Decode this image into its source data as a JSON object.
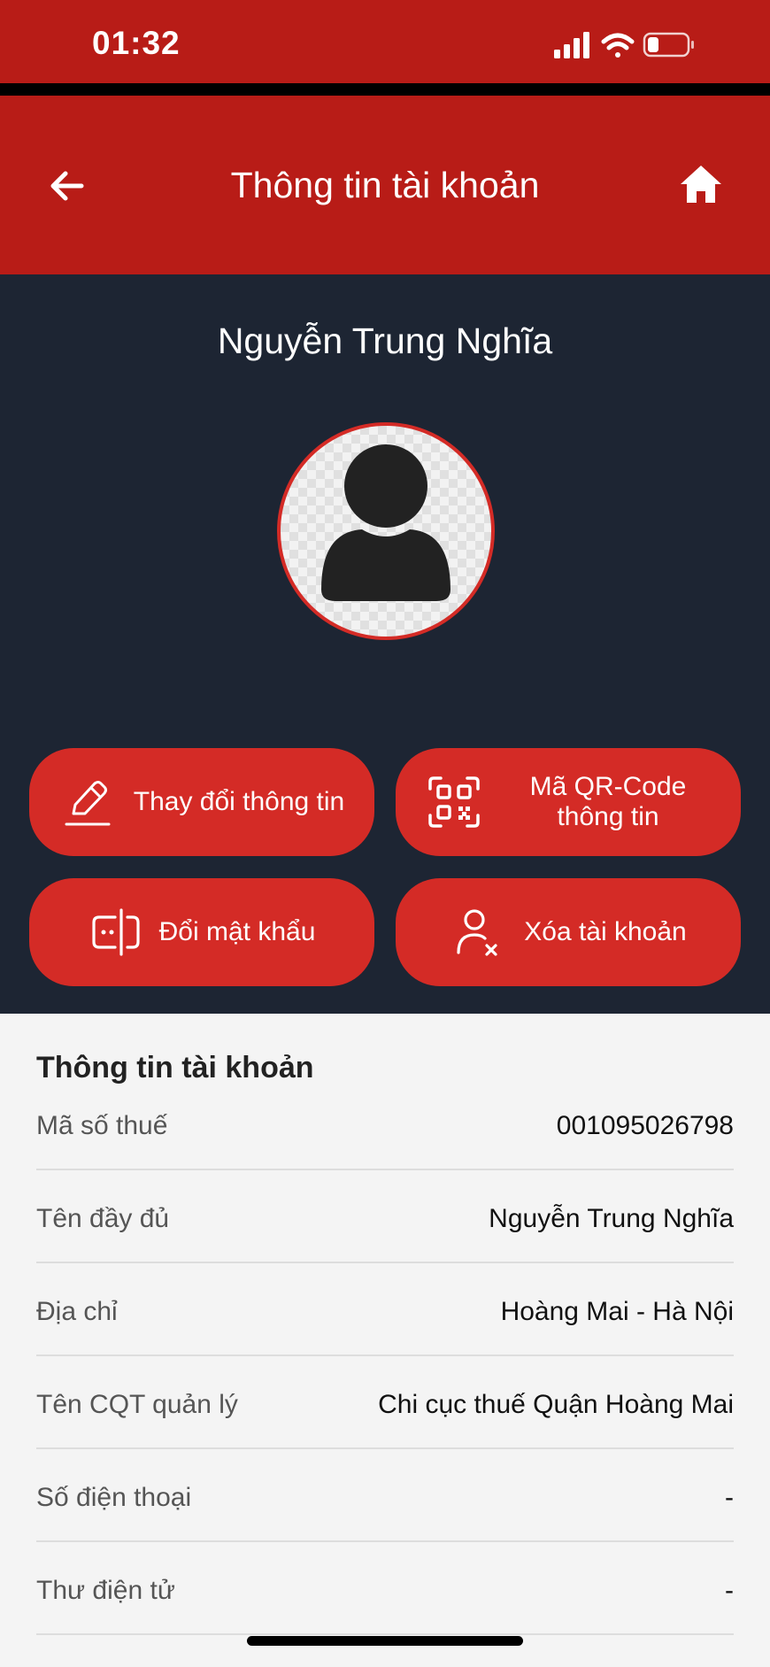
{
  "status_bar": {
    "time": "01:32"
  },
  "header": {
    "title": "Thông tin tài khoản"
  },
  "profile": {
    "name": "Nguyễn Trung Nghĩa"
  },
  "actions": {
    "edit": "Thay đổi thông tin",
    "qr": "Mã QR-Code thông tin",
    "change_password": "Đổi mật khẩu",
    "delete": "Xóa tài khoản"
  },
  "account_info": {
    "title": "Thông tin tài khoản",
    "rows": [
      {
        "label": "Mã số thuế",
        "value": "001095026798"
      },
      {
        "label": "Tên đầy đủ",
        "value": "Nguyễn Trung Nghĩa"
      },
      {
        "label": "Địa chỉ",
        "value": "Hoàng Mai - Hà Nội"
      },
      {
        "label": "Tên CQT quản lý",
        "value": "Chi cục thuế Quận Hoàng Mai"
      },
      {
        "label": "Số điện thoại",
        "value": "-"
      },
      {
        "label": "Thư điện tử",
        "value": "-"
      }
    ]
  },
  "colors": {
    "primary_red": "#b81c17",
    "button_red": "#d42b26",
    "dark_bg": "#1d2533"
  },
  "icons": [
    "back-arrow-icon",
    "home-icon",
    "pencil-icon",
    "qr-code-icon",
    "password-icon",
    "user-remove-icon"
  ]
}
